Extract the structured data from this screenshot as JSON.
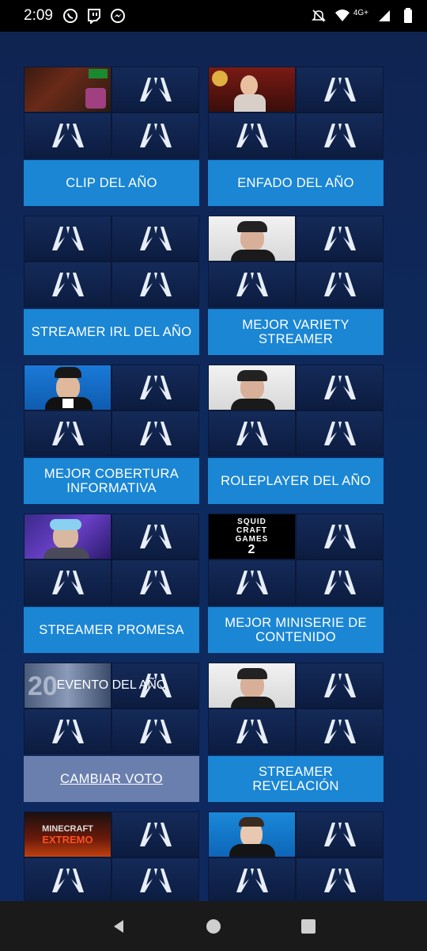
{
  "status_bar": {
    "time": "2:09",
    "left_icons": [
      "whatsapp-icon",
      "twitch-icon",
      "messenger-icon"
    ],
    "right_icons": [
      "mute-icon",
      "wifi-icon",
      "signal-icon",
      "battery-icon"
    ],
    "network": "4G+"
  },
  "colors": {
    "background": "#0f2350",
    "button": "#1a86d4",
    "button_voted": "#6a7fae",
    "tile": "#142a58"
  },
  "cards": [
    {
      "label": "CLIP DEL AÑO",
      "state": "default",
      "photo": "gameplay-clip-thumbnail",
      "photo_tile": 0
    },
    {
      "label": "ENFADO DEL AÑO",
      "state": "default",
      "photo": "streamer-stream-thumbnail",
      "photo_tile": 0
    },
    {
      "label": "STREAMER IRL DEL AÑO",
      "state": "default",
      "photo": null,
      "photo_tile": -1
    },
    {
      "label": "MEJOR VARIETY STREAMER",
      "state": "default",
      "photo": "streamer-portrait-cap",
      "photo_tile": 0
    },
    {
      "label": "MEJOR COBERTURA INFORMATIVA",
      "state": "default",
      "photo": "streamer-portrait-tuxedo",
      "photo_tile": 0
    },
    {
      "label": "ROLEPLAYER DEL AÑO",
      "state": "default",
      "photo": "streamer-portrait-cap",
      "photo_tile": 0
    },
    {
      "label": "STREAMER PROMESA",
      "state": "default",
      "photo": "streamer-portrait-headset",
      "photo_tile": 0
    },
    {
      "label": "MEJOR MINISERIE DE CONTENIDO",
      "state": "default",
      "photo": "squid-craft-games-2-logo",
      "photo_tile": 0
    },
    {
      "label": "CAMBIAR VOTO",
      "state": "voted",
      "photo": "event-thumbnail",
      "photo_tile": 0,
      "overlay": "EVENTO DEL AÑO"
    },
    {
      "label": "STREAMER REVELACIÓN",
      "state": "default",
      "photo": "streamer-portrait-cap",
      "photo_tile": 0
    },
    {
      "label": "",
      "state": "default",
      "photo": "minecraft-extremo-thumbnail",
      "photo_tile": 0
    },
    {
      "label": "",
      "state": "default",
      "photo": "streamer-portrait-suit",
      "photo_tile": 0
    }
  ],
  "photo_texts": {
    "squid": [
      "SQUID",
      "CRAFT",
      "GAMES",
      "2"
    ],
    "minecraft": [
      "MINECRAFT",
      "EXTREMO"
    ],
    "event": "20"
  },
  "nav_bar": {
    "buttons": [
      "back-icon",
      "home-icon",
      "recents-icon"
    ]
  }
}
